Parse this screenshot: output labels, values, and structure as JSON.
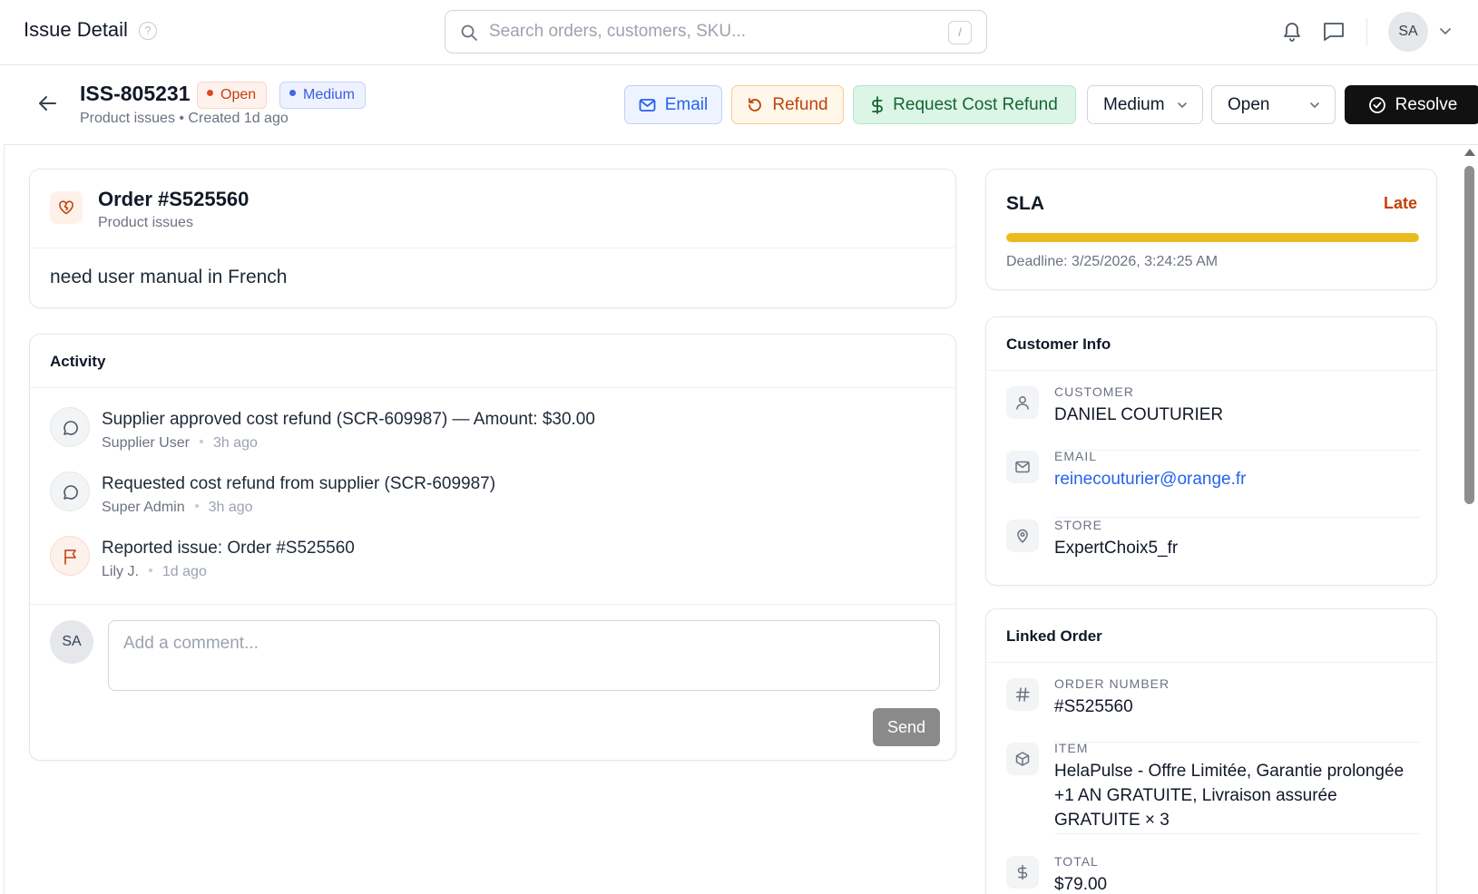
{
  "topbar": {
    "title": "Issue Detail",
    "help_glyph": "?",
    "search_placeholder": "Search orders, customers, SKU...",
    "search_shortcut": "/",
    "user_initials": "SA"
  },
  "issue": {
    "id": "ISS-805231",
    "status_pill": "Open",
    "priority_pill": "Medium",
    "subtitle": "Product issues • Created 1d ago",
    "actions": {
      "email": "Email",
      "refund": "Refund",
      "request_cost_refund": "Request Cost Refund",
      "priority_select": "Medium",
      "status_select": "Open",
      "resolve": "Resolve"
    }
  },
  "order_card": {
    "title": "Order #S525560",
    "subtitle": "Product issues",
    "description": "need user manual in French"
  },
  "activity": {
    "heading": "Activity",
    "items": [
      {
        "icon": "message-icon",
        "text": "Supplier approved cost refund (SCR-609987) — Amount: $30.00",
        "author": "Supplier User",
        "time": "3h ago"
      },
      {
        "icon": "message-icon",
        "text": "Requested cost refund from supplier (SCR-609987)",
        "author": "Super Admin",
        "time": "3h ago"
      },
      {
        "icon": "flag-icon",
        "text": "Reported issue: Order #S525560",
        "author": "Lily J.",
        "time": "1d ago"
      }
    ],
    "comment_avatar": "SA",
    "comment_placeholder": "Add a comment...",
    "send_label": "Send"
  },
  "sla": {
    "title": "SLA",
    "status": "Late",
    "progress_fraction": 1.0,
    "deadline": "Deadline: 3/25/2026, 3:24:25 AM",
    "bar_color": "#ebbb1e",
    "status_color": "#c2410c"
  },
  "customer_info": {
    "heading": "Customer Info",
    "customer_label": "CUSTOMER",
    "customer_value": "DANIEL COUTURIER",
    "email_label": "EMAIL",
    "email_value": "reinecouturier@orange.fr",
    "store_label": "STORE",
    "store_value": "ExpertChoix5_fr"
  },
  "linked_order": {
    "heading": "Linked Order",
    "order_number_label": "ORDER NUMBER",
    "order_number_value": "#S525560",
    "item_label": "ITEM",
    "item_value": "HelaPulse - Offre Limitée, Garantie prolongée +1 AN GRATUITE, Livraison assurée GRATUITE × 3",
    "total_label": "TOTAL",
    "total_value": "$79.00"
  },
  "colors": {
    "accent_blue": "#2563eb",
    "open_red": "#c2410c",
    "resolve_bg": "#111111"
  }
}
